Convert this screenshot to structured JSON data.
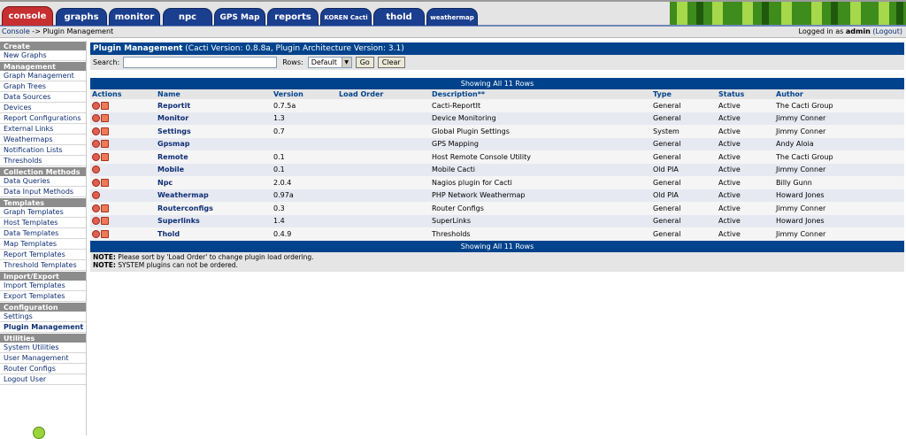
{
  "tabs": [
    {
      "label": "console",
      "active": true
    },
    {
      "label": "graphs"
    },
    {
      "label": "monitor"
    },
    {
      "label": "npc"
    },
    {
      "label": "GPS Map"
    },
    {
      "label": "reports"
    },
    {
      "label": "KOREN Cacti"
    },
    {
      "label": "thold"
    },
    {
      "label": "weathermap"
    }
  ],
  "breadcrumb": {
    "root": "Console",
    "sep": " -> ",
    "current": "Plugin Management"
  },
  "login": {
    "prefix": "Logged in as",
    "user": "admin",
    "logout": "(Logout)"
  },
  "sidebar": {
    "sections": [
      {
        "heading": "Create",
        "items": [
          "New Graphs"
        ]
      },
      {
        "heading": "Management",
        "items": [
          "Graph Management",
          "Graph Trees",
          "Data Sources",
          "Devices",
          "Report Configurations",
          "External Links",
          "Weathermaps",
          "Notification Lists",
          "Thresholds"
        ]
      },
      {
        "heading": "Collection Methods",
        "items": [
          "Data Queries",
          "Data Input Methods"
        ]
      },
      {
        "heading": "Templates",
        "items": [
          "Graph Templates",
          "Host Templates",
          "Data Templates",
          "Map Templates",
          "Report Templates",
          "Threshold Templates"
        ]
      },
      {
        "heading": "Import/Export",
        "items": [
          "Import Templates",
          "Export Templates"
        ]
      },
      {
        "heading": "Configuration",
        "items": [
          "Settings",
          "Plugin Management"
        ]
      },
      {
        "heading": "Utilities",
        "items": [
          "System Utilities",
          "User Management",
          "Router Configs",
          "Logout User"
        ]
      }
    ],
    "selected": "Plugin Management"
  },
  "main": {
    "title_bold": "Plugin Management",
    "title_rest": " (Cacti Version: 0.8.8a, Plugin Architecture Version: 3.1)",
    "search_label": "Search:",
    "search_value": "",
    "rows_label": "Rows:",
    "rows_value": "Default",
    "go_label": "Go",
    "clear_label": "Clear",
    "showing_top": "Showing All 11 Rows",
    "showing_bottom": "Showing All 11 Rows",
    "columns": [
      "Actions",
      "Name",
      "Version",
      "Load Order",
      "Description**",
      "Type",
      "Status",
      "Author"
    ],
    "rows": [
      {
        "actions": 2,
        "name": "Reportit",
        "version": "0.7.5a",
        "description": "Cacti-ReportIt",
        "type": "General",
        "status": "Active",
        "author": "The Cacti Group"
      },
      {
        "actions": 2,
        "name": "Monitor",
        "version": "1.3",
        "description": "Device Monitoring",
        "type": "General",
        "status": "Active",
        "author": "Jimmy Conner"
      },
      {
        "actions": 2,
        "name": "Settings",
        "version": "0.7",
        "description": "Global Plugin Settings",
        "type": "System",
        "status": "Active",
        "author": "Jimmy Conner"
      },
      {
        "actions": 2,
        "name": "Gpsmap",
        "version": "",
        "description": "GPS Mapping",
        "type": "General",
        "status": "Active",
        "author": "Andy Aloia"
      },
      {
        "actions": 2,
        "name": "Remote",
        "version": "0.1",
        "description": "Host Remote Console Utility",
        "type": "General",
        "status": "Active",
        "author": "The Cacti Group"
      },
      {
        "actions": 1,
        "name": "Mobile",
        "version": "0.1",
        "description": "Mobile Cacti",
        "type": "Old PIA",
        "status": "Active",
        "author": "Jimmy Conner"
      },
      {
        "actions": 2,
        "name": "Npc",
        "version": "2.0.4",
        "description": "Nagios plugin for Cacti",
        "type": "General",
        "status": "Active",
        "author": "Billy Gunn"
      },
      {
        "actions": 1,
        "name": "Weathermap",
        "version": "0.97a",
        "description": "PHP Network Weathermap",
        "type": "Old PIA",
        "status": "Active",
        "author": "Howard Jones"
      },
      {
        "actions": 2,
        "name": "Routerconfigs",
        "version": "0.3",
        "description": "Router Configs",
        "type": "General",
        "status": "Active",
        "author": "Jimmy Conner"
      },
      {
        "actions": 2,
        "name": "Superlinks",
        "version": "1.4",
        "description": "SuperLinks",
        "type": "General",
        "status": "Active",
        "author": "Howard Jones"
      },
      {
        "actions": 2,
        "name": "Thold",
        "version": "0.4.9",
        "description": "Thresholds",
        "type": "General",
        "status": "Active",
        "author": "Jimmy Conner"
      }
    ],
    "notes": [
      {
        "label": "NOTE:",
        "text": " Please sort by 'Load Order' to change plugin load ordering."
      },
      {
        "label": "NOTE:",
        "text": " SYSTEM plugins can not be ordered."
      }
    ]
  },
  "colors": {
    "accent": "#00438c",
    "active_tab": "#c63030",
    "tab": "#1b3f8f",
    "link": "#0d2e73"
  }
}
